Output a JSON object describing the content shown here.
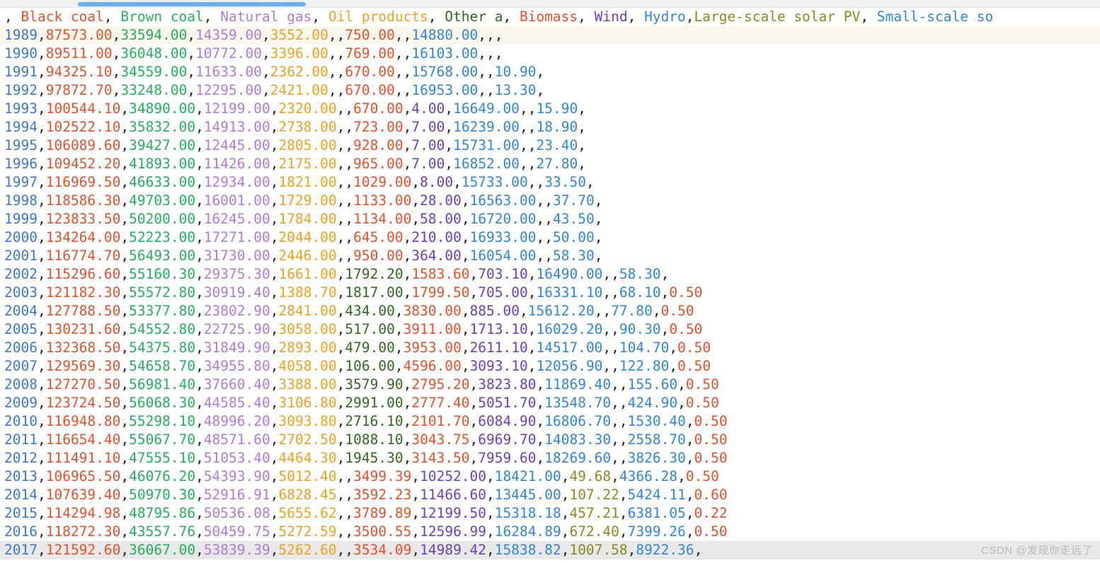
{
  "scrollbar": {
    "orientation": "horizontal",
    "thumb_color": "#69aef0",
    "track_color": "#f1f1f1"
  },
  "watermark": {
    "text": "CSDN @发现你走远了"
  },
  "columns": [
    "",
    "Black coal",
    "Brown coal",
    "Natural gas",
    "Oil products",
    "Other a",
    "Biomass",
    "Wind",
    "Hydro",
    "Large-scale solar PV",
    "Small-scale so"
  ],
  "column_colors": [
    "#3a78d6",
    "#e8502a",
    "#22b25a",
    "#b07ae0",
    "#f2a01e",
    "#2f6b1e",
    "#ef4e28",
    "#6a3fc0",
    "#2f85e0",
    "#8a8a1e",
    "#2f85e0"
  ],
  "header_line": ", Black coal, Brown coal, Natural gas, Oil products, Other a, Biomass, Wind, Hydro,Large-scale solar PV, Small-scale so",
  "current_line_number": 29,
  "rows": [
    {
      "cells": [
        "1989",
        "87573.00",
        "33594.00",
        "14359.00",
        "3552.00",
        "",
        "750.00",
        "",
        "14880.00",
        "",
        "",
        ""
      ],
      "band": true
    },
    {
      "cells": [
        "1990",
        "89511.00",
        "36048.00",
        "10772.00",
        "3396.00",
        "",
        "769.00",
        "",
        "16103.00",
        "",
        "",
        ""
      ],
      "band": false
    },
    {
      "cells": [
        "1991",
        "94325.10",
        "34559.00",
        "11633.00",
        "2362.00",
        "",
        "670.00",
        "",
        "15768.00",
        "",
        "10.90",
        ""
      ],
      "band": false
    },
    {
      "cells": [
        "1992",
        "97872.70",
        "33248.00",
        "12295.00",
        "2421.00",
        "",
        "670.00",
        "",
        "16953.00",
        "",
        "13.30",
        ""
      ],
      "band": false
    },
    {
      "cells": [
        "1993",
        "100544.10",
        "34890.00",
        "12199.00",
        "2320.00",
        "",
        "670.00",
        "4.00",
        "16649.00",
        "",
        "15.90",
        ""
      ],
      "band": false
    },
    {
      "cells": [
        "1994",
        "102522.10",
        "35832.00",
        "14913.00",
        "2738.00",
        "",
        "723.00",
        "7.00",
        "16239.00",
        "",
        "18.90",
        ""
      ],
      "band": false
    },
    {
      "cells": [
        "1995",
        "106089.60",
        "39427.00",
        "12445.00",
        "2805.00",
        "",
        "928.00",
        "7.00",
        "15731.00",
        "",
        "23.40",
        ""
      ],
      "band": false
    },
    {
      "cells": [
        "1996",
        "109452.20",
        "41893.00",
        "11426.00",
        "2175.00",
        "",
        "965.00",
        "7.00",
        "16852.00",
        "",
        "27.80",
        ""
      ],
      "band": false
    },
    {
      "cells": [
        "1997",
        "116969.50",
        "46633.00",
        "12934.00",
        "1821.00",
        "",
        "1029.00",
        "8.00",
        "15733.00",
        "",
        "33.50",
        ""
      ],
      "band": false
    },
    {
      "cells": [
        "1998",
        "118586.30",
        "49703.00",
        "16001.00",
        "1729.00",
        "",
        "1133.00",
        "28.00",
        "16563.00",
        "",
        "37.70",
        ""
      ],
      "band": false
    },
    {
      "cells": [
        "1999",
        "123833.50",
        "50200.00",
        "16245.00",
        "1784.00",
        "",
        "1134.00",
        "58.00",
        "16720.00",
        "",
        "43.50",
        ""
      ],
      "band": false
    },
    {
      "cells": [
        "2000",
        "134264.00",
        "52223.00",
        "17271.00",
        "2044.00",
        "",
        "645.00",
        "210.00",
        "16933.00",
        "",
        "50.00",
        ""
      ],
      "band": false
    },
    {
      "cells": [
        "2001",
        "116774.70",
        "56493.00",
        "31730.00",
        "2446.00",
        "",
        "950.00",
        "364.00",
        "16054.00",
        "",
        "58.30",
        ""
      ],
      "band": false
    },
    {
      "cells": [
        "2002",
        "115296.60",
        "55160.30",
        "29375.30",
        "1661.00",
        "1792.20",
        "1583.60",
        "703.10",
        "16490.00",
        "",
        "58.30",
        ""
      ],
      "band": false
    },
    {
      "cells": [
        "2003",
        "121182.30",
        "55572.80",
        "30919.40",
        "1388.70",
        "1817.00",
        "1799.50",
        "705.00",
        "16331.10",
        "",
        "68.10",
        "0.50"
      ],
      "band": false
    },
    {
      "cells": [
        "2004",
        "127788.50",
        "53377.80",
        "23802.90",
        "2841.00",
        "434.00",
        "3830.00",
        "885.00",
        "15612.20",
        "",
        "77.80",
        "0.50"
      ],
      "band": false
    },
    {
      "cells": [
        "2005",
        "130231.60",
        "54552.80",
        "22725.90",
        "3058.00",
        "517.00",
        "3911.00",
        "1713.10",
        "16029.20",
        "",
        "90.30",
        "0.50"
      ],
      "band": false
    },
    {
      "cells": [
        "2006",
        "132368.50",
        "54375.80",
        "31849.90",
        "2893.00",
        "479.00",
        "3953.00",
        "2611.10",
        "14517.00",
        "",
        "104.70",
        "0.50"
      ],
      "band": false
    },
    {
      "cells": [
        "2007",
        "129569.30",
        "54658.70",
        "34955.80",
        "4058.00",
        "106.00",
        "4596.00",
        "3093.10",
        "12056.90",
        "",
        "122.80",
        "0.50"
      ],
      "band": false
    },
    {
      "cells": [
        "2008",
        "127270.50",
        "56981.40",
        "37660.40",
        "3388.00",
        "3579.90",
        "2795.20",
        "3823.80",
        "11869.40",
        "",
        "155.60",
        "0.50"
      ],
      "band": false
    },
    {
      "cells": [
        "2009",
        "123724.50",
        "56068.30",
        "44585.40",
        "3106.80",
        "2991.00",
        "2777.40",
        "5051.70",
        "13548.70",
        "",
        "424.90",
        "0.50"
      ],
      "band": false
    },
    {
      "cells": [
        "2010",
        "116948.80",
        "55298.10",
        "48996.20",
        "3093.80",
        "2716.10",
        "2101.70",
        "6084.90",
        "16806.70",
        "",
        "1530.40",
        "0.50"
      ],
      "band": false
    },
    {
      "cells": [
        "2011",
        "116654.40",
        "55067.70",
        "48571.60",
        "2702.50",
        "1088.10",
        "3043.75",
        "6969.70",
        "14083.30",
        "",
        "2558.70",
        "0.50"
      ],
      "band": false
    },
    {
      "cells": [
        "2012",
        "111491.10",
        "47555.10",
        "51053.40",
        "4464.30",
        "1945.30",
        "3143.50",
        "7959.60",
        "18269.60",
        "",
        "3826.30",
        "0.50"
      ],
      "band": false
    },
    {
      "cells": [
        "2013",
        "106965.50",
        "46076.20",
        "54393.90",
        "5012.40",
        "",
        "3499.39",
        "10252.00",
        "18421.00",
        "49.68",
        "4366.28",
        "0.50"
      ],
      "band": false
    },
    {
      "cells": [
        "2014",
        "107639.40",
        "50970.30",
        "52916.91",
        "6828.45",
        "",
        "3592.23",
        "11466.60",
        "13445.00",
        "107.22",
        "5424.11",
        "0.60"
      ],
      "band": false
    },
    {
      "cells": [
        "2015",
        "114294.98",
        "48795.86",
        "50536.08",
        "5655.62",
        "",
        "3789.89",
        "12199.50",
        "15318.18",
        "457.21",
        "6381.05",
        "0.22"
      ],
      "band": false
    },
    {
      "cells": [
        "2016",
        "118272.30",
        "43557.76",
        "50459.75",
        "5272.59",
        "",
        "3500.55",
        "12596.99",
        "16284.89",
        "672.40",
        "7399.26",
        "0.50"
      ],
      "band": false
    },
    {
      "cells": [
        "2017",
        "121592.60",
        "36067.00",
        "53839.39",
        "5262.60",
        "",
        "3534.09",
        "14989.42",
        "15838.82",
        "1007.58",
        "8922.36",
        ""
      ],
      "band": false,
      "current": true
    }
  ]
}
